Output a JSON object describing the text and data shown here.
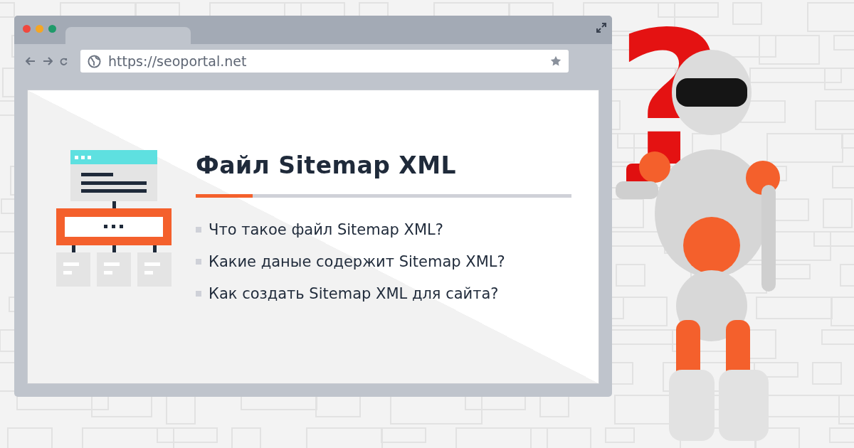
{
  "browser": {
    "url": "https://seoportal.net"
  },
  "article": {
    "title": "Файл Sitemap XML",
    "bullets": [
      "Что такое файл Sitemap XML?",
      "Какие даные содержит Sitemap XML?",
      "Как создать Sitemap XML для сайта?"
    ]
  },
  "robot": {
    "prop": "?"
  }
}
